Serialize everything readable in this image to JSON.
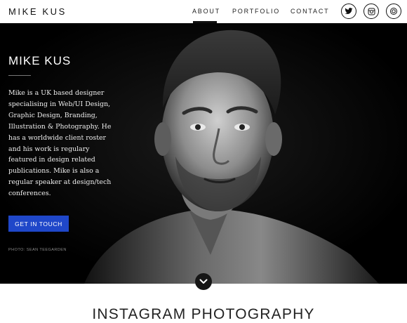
{
  "header": {
    "logo": "MIKE KUS",
    "nav": [
      {
        "label": "ABOUT",
        "active": true
      },
      {
        "label": "PORTFOLIO",
        "active": false
      },
      {
        "label": "CONTACT",
        "active": false
      }
    ],
    "social_icons": [
      "twitter-icon",
      "instagram-icon",
      "dribbble-icon"
    ]
  },
  "hero": {
    "title": "MIKE KUS",
    "bio": "Mike is a UK based designer specialising in Web/UI Design, Graphic Design, Branding, Illustration & Photography. He has a worldwide client roster and his work is regulary featured in design related publications. Mike is also a regular speaker at design/tech conferences.",
    "cta_label": "GET IN TOUCH",
    "photo_credit": "PHOTO: SEAN TEEGARDEN",
    "scroll_icon": "chevron-down-icon"
  },
  "section": {
    "title": "INSTAGRAM PHOTOGRAPHY"
  },
  "colors": {
    "accent": "#1f47c9",
    "hero_bg": "#000000",
    "text_dark": "#111111"
  }
}
